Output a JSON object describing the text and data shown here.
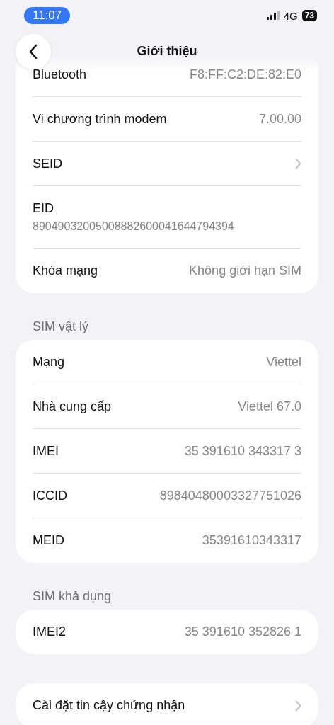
{
  "status_bar": {
    "time": "11:07",
    "network": "4G",
    "battery": "73"
  },
  "nav": {
    "title": "Giới thiệu"
  },
  "sections": [
    {
      "rows": [
        {
          "kind": "value",
          "label": "Bluetooth",
          "value": "F8:FF:C2:DE:82:E0"
        },
        {
          "kind": "value",
          "label": "Vi chương trình modem",
          "value": "7.00.00"
        },
        {
          "kind": "link",
          "label": "SEID"
        },
        {
          "kind": "stacked",
          "label": "EID",
          "value": "89049032005008882600041644794394"
        },
        {
          "kind": "value",
          "label": "Khóa mạng",
          "value": "Không giới hạn SIM"
        }
      ]
    },
    {
      "header": "SIM vật lý",
      "rows": [
        {
          "kind": "value",
          "label": "Mạng",
          "value": "Viettel"
        },
        {
          "kind": "value",
          "label": "Nhà cung cấp",
          "value": "Viettel 67.0"
        },
        {
          "kind": "value",
          "label": "IMEI",
          "value": "35 391610 343317 3"
        },
        {
          "kind": "value",
          "label": "ICCID",
          "value": "89840480003327751026"
        },
        {
          "kind": "value",
          "label": "MEID",
          "value": "35391610343317"
        }
      ]
    },
    {
      "header": "SIM khả dụng",
      "rows": [
        {
          "kind": "value",
          "label": "IMEI2",
          "value": "35 391610 352826 1"
        }
      ]
    },
    {
      "rows": [
        {
          "kind": "link",
          "label": "Cài đặt tin cậy chứng nhận"
        }
      ]
    }
  ]
}
